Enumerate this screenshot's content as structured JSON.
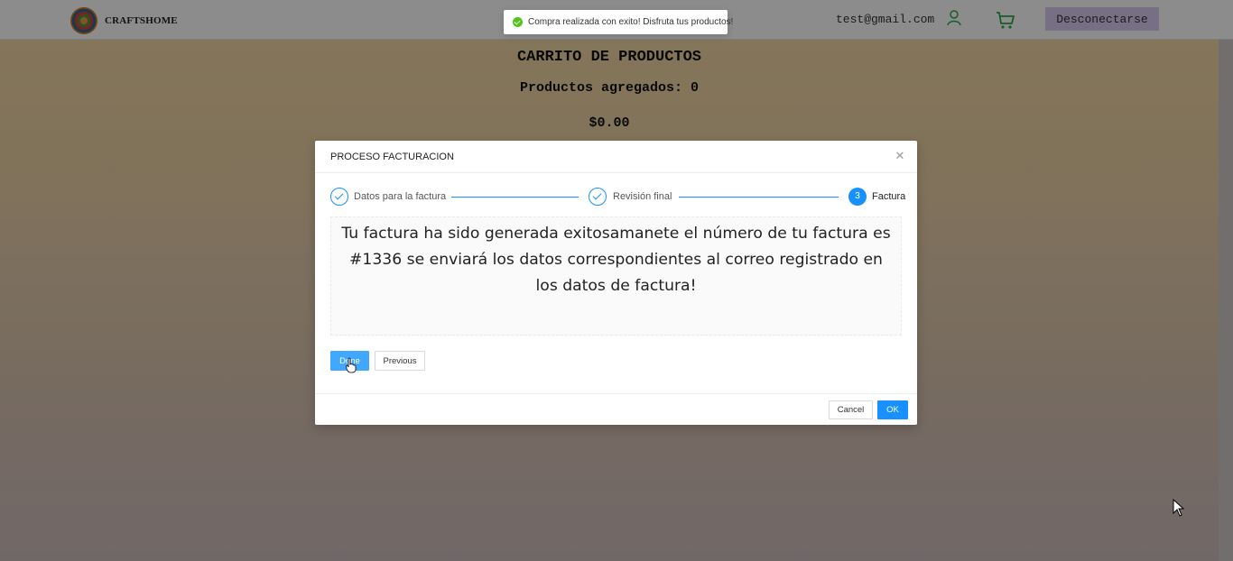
{
  "header": {
    "brand": "CRAFTSHOME",
    "email": "test@gmail.com",
    "logout_label": "Desconectarse"
  },
  "cart": {
    "title": "CARRITO DE PRODUCTOS",
    "count_label": "Productos agregados: 0",
    "total": "$0.00"
  },
  "toast": {
    "message": "Compra realizada con exito! Disfruta tus productos!"
  },
  "modal": {
    "title": "PROCESO FACTURACION",
    "steps": [
      {
        "label": "Datos para la factura",
        "status": "done"
      },
      {
        "label": "Revisión final",
        "status": "done"
      },
      {
        "label": "Factura",
        "status": "active",
        "number": "3"
      }
    ],
    "result_message": "Tu factura ha sido generada exitosamanete el número de tu factura es #1336 se enviará los datos correspondientes al correo registrado en los datos de factura!",
    "done_label": "Done",
    "previous_label": "Previous",
    "cancel_label": "Cancel",
    "ok_label": "OK"
  },
  "colors": {
    "primary": "#1890ff",
    "success": "#52c41a",
    "logout_bg": "#d9ccf2"
  }
}
